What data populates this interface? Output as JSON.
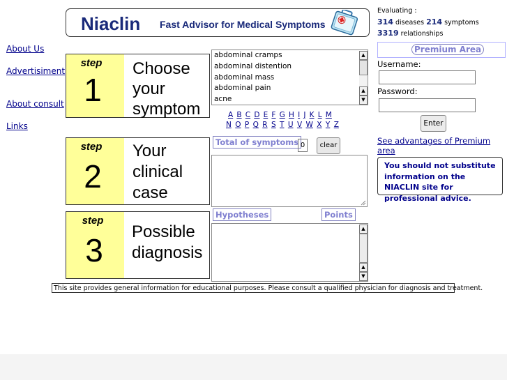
{
  "header": {
    "logo": "Niaclin",
    "tagline": "Fast Advisor for Medical Symptoms",
    "kit_icon": "first-aid-kit-icon"
  },
  "nav": {
    "links": [
      "About Us ",
      "Advertisiment",
      "About consult",
      "Links"
    ]
  },
  "steps": [
    {
      "label": "step",
      "number": "1",
      "lines": [
        "Choose",
        "your",
        "symptom"
      ]
    },
    {
      "label": "step",
      "number": "2",
      "lines": [
        "Your",
        "clinical",
        "case"
      ]
    },
    {
      "label": "step",
      "number": "3",
      "lines": [
        "Possible",
        "diagnosis"
      ]
    }
  ],
  "symptom_list": {
    "items": [
      "abdominal cramps",
      "abdominal distention",
      "abdominal mass",
      "abdominal pain",
      "acne"
    ]
  },
  "alphabet": {
    "row1": [
      "A",
      "B",
      "C",
      "D",
      "E",
      "F",
      "G",
      "H",
      "I",
      "J",
      "K",
      "L",
      "M"
    ],
    "row2": [
      "N",
      "O",
      "P",
      "Q",
      "R",
      "S",
      "T",
      "U",
      "V",
      "W",
      "X",
      "Y",
      "Z"
    ]
  },
  "clinical_case": {
    "total_label": "Total of symptoms",
    "count": "0",
    "clear_label": "clear"
  },
  "diagnosis": {
    "hypotheses_label": "Hypotheses",
    "points_label": "Points"
  },
  "stats": {
    "evaluating_label": "Evaluating :",
    "diseases_count": "314",
    "diseases_label": "diseases",
    "symptoms_count": "214",
    "symptoms_label": "symptoms",
    "relationships_count": "3319",
    "relationships_label": "relationships"
  },
  "premium": {
    "title": "Premium Area",
    "username_label": "Username:",
    "password_label": "Password:",
    "enter_label": "Enter",
    "advantages_link": "See advantages of Premium area "
  },
  "notice": "You should not substitute information on the NIACLIN site for professional advice.",
  "disclaimer": "This site provides general information for educational purposes. Please consult a qualified physician for diagnosis and treatment.",
  "colors": {
    "navy": "#1a2a7a",
    "link": "#00008b",
    "step_yellow": "#ffff99",
    "tag_purple": "#8080d0"
  }
}
